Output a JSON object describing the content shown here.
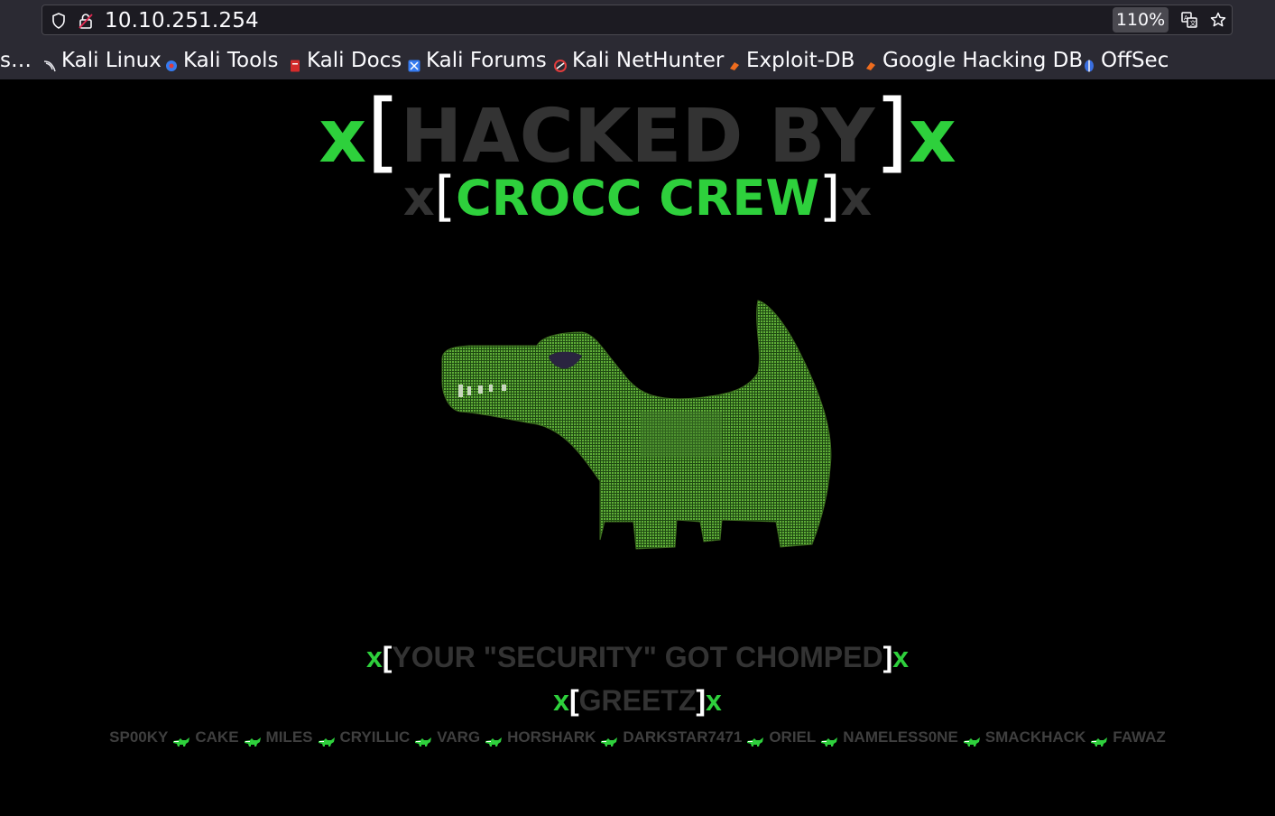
{
  "browser": {
    "url": "10.10.251.254",
    "zoom": "110%",
    "bookmarks": [
      {
        "label": "s…",
        "icon": "bookmark-truncated"
      },
      {
        "label": "Kali Linux",
        "icon": "kali-dragon-icon"
      },
      {
        "label": "Kali Tools",
        "icon": "kali-tools-icon"
      },
      {
        "label": "Kali Docs",
        "icon": "kali-docs-icon"
      },
      {
        "label": "Kali Forums",
        "icon": "kali-forums-icon"
      },
      {
        "label": "Kali NetHunter",
        "icon": "nethunter-icon"
      },
      {
        "label": "Exploit-DB",
        "icon": "exploit-db-icon"
      },
      {
        "label": "Google Hacking DB",
        "icon": "ghdb-icon"
      },
      {
        "label": "OffSec",
        "icon": "offsec-icon"
      }
    ]
  },
  "page": {
    "title": {
      "x_left": "x",
      "open": "[",
      "text": "HACKED BY",
      "close": "]",
      "x_right": "x"
    },
    "subtitle": {
      "x_left": "x",
      "open": "[",
      "text": "CROCC CREW",
      "close": "]",
      "x_right": "x"
    },
    "chomped": {
      "x_left": "x",
      "open": "[",
      "text": "YOUR \"SECURITY\" GOT CHOMPED",
      "close": "]",
      "x_right": "x"
    },
    "greetz": {
      "x_left": "x",
      "open": "[",
      "text": "GREETZ",
      "close": "]",
      "x_right": "x"
    },
    "greetz_names": [
      "SP00KY",
      "CAKE",
      "MILES",
      "CRYILLIC",
      "VARG",
      "HORSHARK",
      "DARKSTAR7471",
      "ORIEL",
      "NAMELESS0NE",
      "SMACKHACK",
      "FAWAZ"
    ],
    "separator_icon": "crocodile-icon",
    "colors": {
      "green": "#2ed03c",
      "dark_gray": "#333333",
      "white": "#ffffff",
      "background": "#000000"
    }
  }
}
